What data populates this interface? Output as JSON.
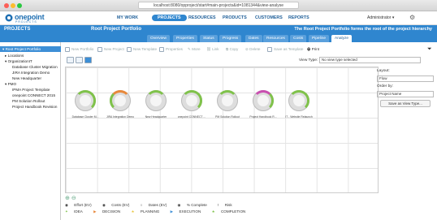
{
  "browser": {
    "url": "localhost:8080/opproject/start#main-projects&id=1081344&view-analyse"
  },
  "logo": {
    "name": "onepoint",
    "sub": "PROJECTS"
  },
  "menu": [
    {
      "label": "MY WORK",
      "active": false
    },
    {
      "label": "PROJECTS",
      "active": true
    },
    {
      "label": "RESOURCES",
      "active": false
    },
    {
      "label": "PRODUCTS",
      "active": false
    },
    {
      "label": "CUSTOMERS",
      "active": false
    },
    {
      "label": "REPORTS",
      "active": false
    }
  ],
  "user": {
    "label": "Administrator ▾"
  },
  "header": {
    "section": "PROJECTS",
    "title": "Root Project Portfolio",
    "description": "The Root Project Portfolio forms the root of the project hierarchy"
  },
  "tabs": [
    "Overview",
    "Properties",
    "Status",
    "Progress",
    "Dates",
    "Resources",
    "Costs",
    "Pipeline",
    "Analyze"
  ],
  "active_tab": "Analyze",
  "tree": [
    {
      "label": "Root Project Portfolio",
      "level": 0,
      "selected": true
    },
    {
      "label": "Locations",
      "level": 1
    },
    {
      "label": "OrganizationIT",
      "level": 1
    },
    {
      "label": "Database Cluster Migration",
      "level": 2
    },
    {
      "label": "JIRA Integration Demo",
      "level": 2
    },
    {
      "label": "New Headquarter",
      "level": 2
    },
    {
      "label": "PMO",
      "level": 1
    },
    {
      "label": "IPMA Project Template",
      "level": 2
    },
    {
      "label": "onepoint CONNECT 2015",
      "level": 2
    },
    {
      "label": "PM Solution Rollout",
      "level": 2
    },
    {
      "label": "Project Handbook Revision",
      "level": 2
    }
  ],
  "toolbar": [
    {
      "label": "New Portfolio",
      "enabled": false
    },
    {
      "label": "New Project",
      "enabled": false
    },
    {
      "label": "New Template",
      "enabled": false
    },
    {
      "label": "Properties",
      "enabled": false
    },
    {
      "label": "More",
      "enabled": false
    },
    {
      "label": "Link",
      "enabled": false
    },
    {
      "label": "Copy",
      "enabled": false
    },
    {
      "label": "Delete",
      "enabled": false
    },
    {
      "label": "Save as Template",
      "enabled": false
    },
    {
      "label": "Print",
      "enabled": true
    }
  ],
  "view_type": {
    "label": "View Type:",
    "value": "No view type selected"
  },
  "nodes": [
    {
      "label": "Database Cluster M...",
      "color": "#7fc24a"
    },
    {
      "label": "JIRA Integration Demo",
      "color": "#e8883a"
    },
    {
      "label": "New Headquarter",
      "color": "#7fc24a"
    },
    {
      "label": "onepoint CONNECT ...",
      "color": "#7fc24a"
    },
    {
      "label": "PM Solution Rollout",
      "color": "#7fc24a"
    },
    {
      "label": "Project Handbook R...",
      "color": "#c94fb0"
    },
    {
      "label": "IT - Website Relaunch",
      "color": "#7fc24a"
    }
  ],
  "layout": {
    "label": "Layout:",
    "value": "Flow"
  },
  "order_by": {
    "label": "Order by:",
    "value": "Project Name"
  },
  "save_view": {
    "label": "Save as View Type..."
  },
  "legend": {
    "metrics": [
      "Effort (EV)",
      "Costs (EV)",
      "Dates (EV)",
      "% Complete",
      "Risk"
    ],
    "phases": [
      "IDEA",
      "DECISION",
      "PLANNING",
      "EXECUTION",
      "COMPLETION"
    ]
  }
}
